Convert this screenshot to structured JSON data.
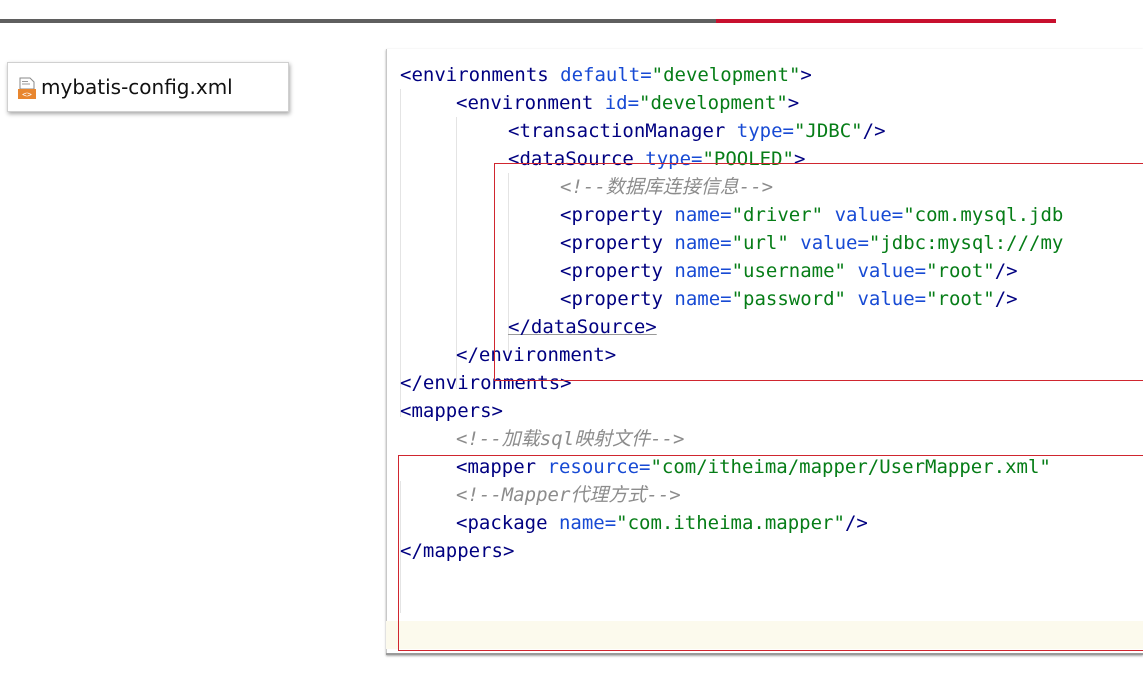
{
  "colors": {
    "accent_red": "#c8102e",
    "bar_gray": "#5f5f5f",
    "highlight_border": "#d0262f",
    "xml_tag": "#000080",
    "xml_attr": "#174ad4",
    "xml_string": "#067d17",
    "xml_comment": "#8c8c8c"
  },
  "file_tab": {
    "icon": "xml-file-icon",
    "name": "mybatis-config.xml"
  },
  "code": {
    "l1": {
      "open": "<environments ",
      "attr": "default=",
      "val": "\"development\"",
      "close": ">"
    },
    "l2": {
      "open": "<environment ",
      "attr": "id=",
      "val": "\"development\"",
      "close": ">"
    },
    "l3": {
      "open": "<transactionManager ",
      "attr": "type=",
      "val": "\"JDBC\"",
      "close": "/>"
    },
    "l4": {
      "open": "<dataSource ",
      "attr": "type=",
      "val": "\"POOLED\"",
      "close": ">"
    },
    "l5": {
      "comment": "<!--数据库连接信息-->"
    },
    "l6": {
      "open": "<property ",
      "attr1": "name=",
      "val1": "\"driver\"",
      "attr2": "value=",
      "val2": "\"com.mysql.jdb"
    },
    "l7": {
      "open": "<property ",
      "attr1": "name=",
      "val1": "\"url\"",
      "attr2": "value=",
      "val2": "\"jdbc:mysql:///my"
    },
    "l8": {
      "open": "<property ",
      "attr1": "name=",
      "val1": "\"username\"",
      "attr2": "value=",
      "val2": "\"root\"",
      "close": "/>"
    },
    "l9": {
      "open": "<property ",
      "attr1": "name=",
      "val1": "\"password\"",
      "attr2": "value=",
      "val2": "\"root\"",
      "close": "/>"
    },
    "l10": {
      "text": "</dataSource>"
    },
    "l11": {
      "text": "</environment>"
    },
    "l12": {
      "text": "</environments>"
    },
    "l13": {
      "text": "<mappers>"
    },
    "l14": {
      "comment": "<!--加载sql映射文件-->"
    },
    "l15": {
      "open": "<mapper ",
      "attr": "resource=",
      "val": "\"com/itheima/mapper/UserMapper.xml\""
    },
    "l16": {
      "comment": "<!--Mapper代理方式-->"
    },
    "l17": {
      "open": "<package ",
      "attr": "name=",
      "val": "\"com.itheima.mapper\"",
      "close": "/>"
    },
    "l18": {
      "text": "</mappers>"
    }
  }
}
